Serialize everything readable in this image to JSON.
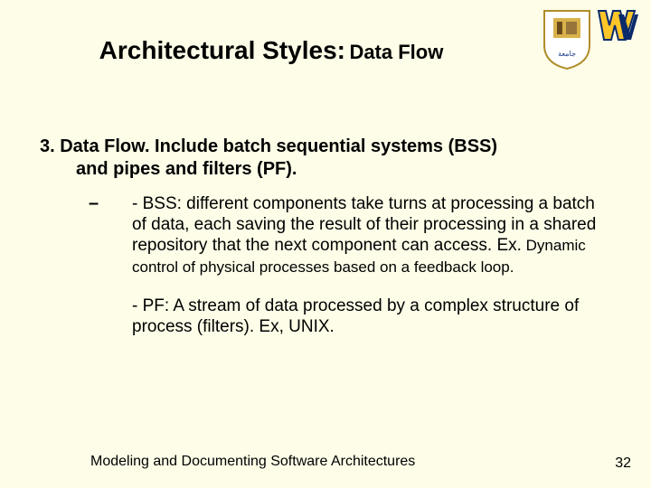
{
  "title": {
    "main": "Architectural Styles:",
    "sub": "Data Flow"
  },
  "body": {
    "numbered": {
      "line1": "3. Data Flow. Include batch sequential systems (BSS)",
      "line2": "and pipes and filters (PF)."
    },
    "bullet_dash": "–",
    "bss": {
      "large": "- BSS: different components take turns at processing a batch of data, each saving the result of their processing in a shared repository that the next component can access. Ex.",
      "small": " Dynamic control of physical processes based on a feedback loop."
    },
    "pf": "- PF: A stream of data processed by a complex structure of process (filters). Ex, UNIX."
  },
  "footer": "Modeling and Documenting Software Architectures",
  "page": "32"
}
